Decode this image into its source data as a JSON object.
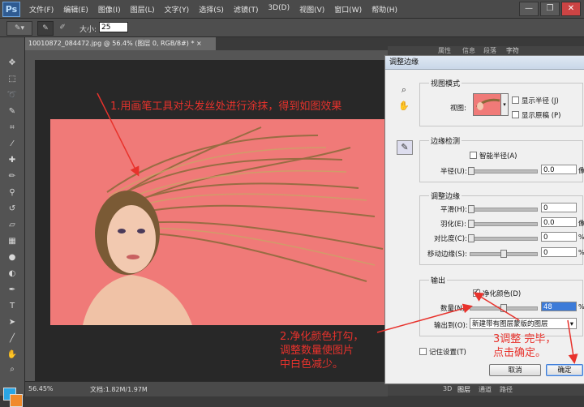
{
  "app": {
    "logo": "Ps",
    "menu": [
      "文件(F)",
      "编辑(E)",
      "图像(I)",
      "图层(L)",
      "文字(Y)",
      "选择(S)",
      "滤镜(T)",
      "3D(D)",
      "视图(V)",
      "窗口(W)",
      "帮助(H)"
    ],
    "window_controls": {
      "minimize": "—",
      "restore": "❐",
      "close": "✕"
    }
  },
  "options_bar": {
    "size_label": "大小:",
    "size_value": "25"
  },
  "document": {
    "tab_title": "10010872_084472.jpg @ 56.4% (图层 0, RGB/8#) *",
    "tab_close": "×",
    "canvas_color": "#f07a78"
  },
  "status": {
    "zoom": "56.45%",
    "doc_info": "文档:1.82M/1.97M"
  },
  "panels": {
    "top_tabs": [
      "属性",
      "信息",
      "段落",
      "字符"
    ],
    "bottom_tabs": [
      "3D",
      "图层",
      "通道",
      "路径"
    ]
  },
  "dialog": {
    "title": "调整边缘",
    "view_mode": {
      "group_label": "视图模式",
      "view_label": "视图:",
      "show_radius": "显示半径 (J)",
      "show_original": "显示原稿 (P)"
    },
    "edge_detection": {
      "group_label": "边缘检测",
      "smart_radius": "智能半径(A)",
      "radius_label": "半径(U):",
      "radius_value": "0.0",
      "radius_unit": "像"
    },
    "adjust_edge": {
      "group_label": "调整边缘",
      "smooth_label": "平滑(H):",
      "smooth_value": "0",
      "feather_label": "羽化(E):",
      "feather_value": "0.0",
      "feather_unit": "像",
      "contrast_label": "对比度(C):",
      "contrast_value": "0",
      "contrast_unit": "%",
      "shift_label": "移动边缘(S):",
      "shift_value": "0",
      "shift_unit": "%"
    },
    "output": {
      "group_label": "输出",
      "decontaminate": "净化颜色(D)",
      "decontaminate_checked": true,
      "amount_label": "数量(N):",
      "amount_value": "48",
      "amount_unit": "%",
      "output_to_label": "输出到(O):",
      "output_to_value": "新建带有图层蒙版的图层"
    },
    "remember": "记住设置(T)",
    "cancel": "取消",
    "ok": "确定"
  },
  "annotations": {
    "note1": "1.用画笔工具对头发丝处进行涂抹，得到如图效果",
    "note2_line1": "2.净化颜色打勾，",
    "note2_line2": "调整数量使图片",
    "note2_line3": "中白色减少。",
    "note3_line1": "3调整 完毕，",
    "note3_line2": "点击确定。"
  },
  "colors": {
    "foreground": "#2aa6e6",
    "background": "#f08a2c",
    "annotation": "#e8322c"
  }
}
